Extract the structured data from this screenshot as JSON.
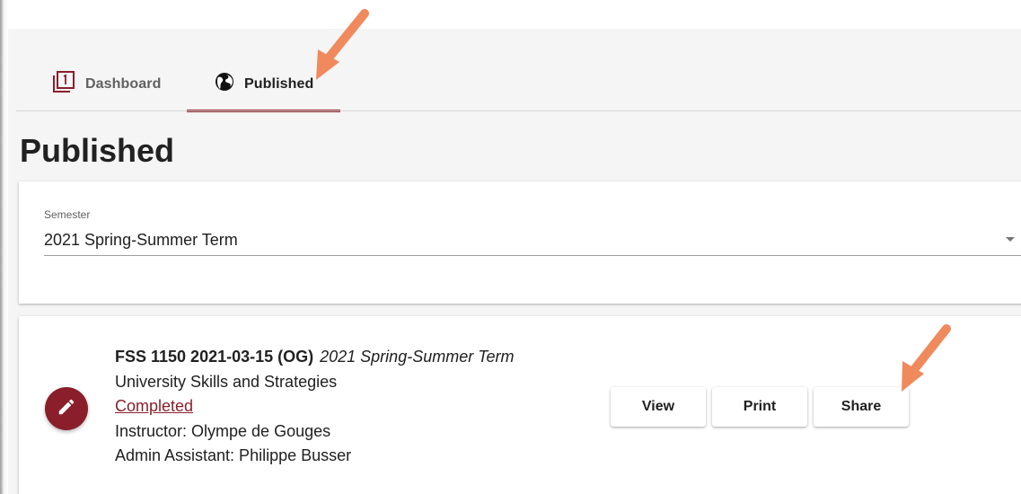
{
  "tabs": [
    {
      "label": "Dashboard",
      "icon": "dashboard-icon",
      "active": false
    },
    {
      "label": "Published",
      "icon": "globe-icon",
      "active": true
    }
  ],
  "page": {
    "title": "Published"
  },
  "filter": {
    "semester_label": "Semester",
    "semester_value": "2021 Spring-Summer Term"
  },
  "course": {
    "code": "FSS 1150 2021-03-15 (OG)",
    "term": "2021 Spring-Summer Term",
    "name": "University Skills and Strategies",
    "status": "Completed",
    "instructor": "Instructor: Olympe de Gouges",
    "admin": "Admin Assistant: Philippe Busser",
    "edit_icon": "pencil-icon"
  },
  "actions": {
    "view_label": "View",
    "print_label": "Print",
    "share_label": "Share"
  },
  "colors": {
    "accent": "#8a1f2b",
    "annotation_arrow": "#f08a5d"
  }
}
